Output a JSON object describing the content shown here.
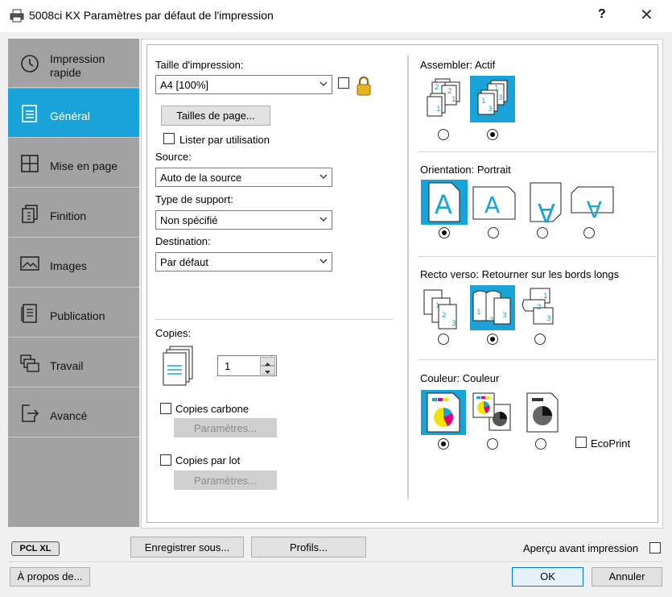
{
  "window": {
    "title": "5008ci KX Paramètres par défaut de l'impression",
    "help_label": "?",
    "close_label": "✕"
  },
  "sidebar": {
    "items": [
      {
        "label_line1": "Impression",
        "label_line2": "rapide",
        "icon": "clock-icon"
      },
      {
        "label": "Général",
        "icon": "document-icon"
      },
      {
        "label": "Mise en page",
        "icon": "layout-grid-icon"
      },
      {
        "label": "Finition",
        "icon": "finishing-icon"
      },
      {
        "label": "Images",
        "icon": "image-icon"
      },
      {
        "label": "Publication",
        "icon": "publication-icon"
      },
      {
        "label": "Travail",
        "icon": "job-icon"
      },
      {
        "label": "Avancé",
        "icon": "advanced-icon"
      }
    ],
    "active_index": 1,
    "colors": {
      "bg": "#a2a2a2",
      "active": "#1aa3d8"
    }
  },
  "general": {
    "print_size_label": "Taille d'impression:",
    "print_size_value": "A4  [100%]",
    "page_sizes_button": "Tailles de page...",
    "list_by_use_label": "Lister par utilisation",
    "source_label": "Source:",
    "source_value": "Auto de la source",
    "media_type_label": "Type de support:",
    "media_type_value": "Non spécifié",
    "destination_label": "Destination:",
    "destination_value": "Par défaut",
    "copies_label": "Copies:",
    "copies_value": "1",
    "carbon_copies_label": "Copies carbone",
    "carbon_settings_button": "Paramètres...",
    "batch_copies_label": "Copies par lot",
    "batch_settings_button": "Paramètres..."
  },
  "collate": {
    "label": "Assembler:",
    "value": "Actif",
    "selected": 1
  },
  "orientation": {
    "label": "Orientation:",
    "value": "Portrait",
    "selected": 0,
    "glyph": "A"
  },
  "duplex": {
    "label": "Recto verso:",
    "value": "Retourner sur les bords longs",
    "selected": 1
  },
  "color": {
    "label": "Couleur:",
    "value": "Couleur",
    "selected": 0,
    "ecoprint_label": "EcoPrint"
  },
  "footer": {
    "pcl_badge": "PCL XL",
    "save_as_button": "Enregistrer sous...",
    "profiles_button": "Profils...",
    "preview_label": "Aperçu avant impression",
    "about_button": "À propos de...",
    "ok_button": "OK",
    "cancel_button": "Annuler"
  },
  "colors": {
    "accent": "#1aa3d8",
    "cyan": "#1aa3d8",
    "magenta": "#e0007a",
    "yellow": "#f2e400"
  }
}
